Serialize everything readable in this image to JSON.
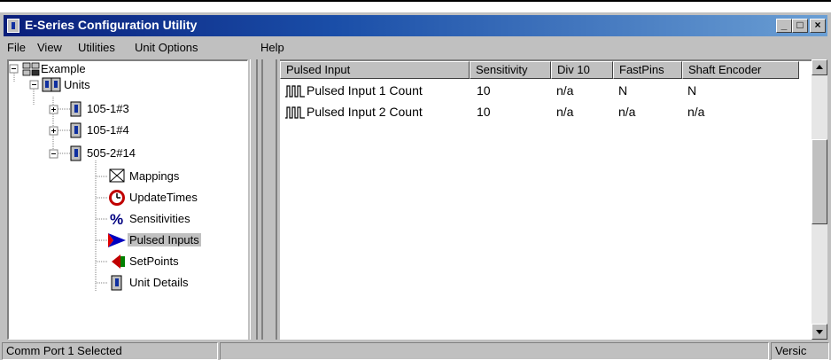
{
  "window": {
    "title": "E-Series Configuration Utility"
  },
  "menu": [
    "File",
    "View",
    "Utilities",
    "Unit Options",
    "Help"
  ],
  "tree": {
    "root": "Example",
    "units_label": "Units",
    "units": [
      "105-1#3",
      "105-1#4",
      "505-2#14"
    ],
    "children": [
      "Mappings",
      "UpdateTimes",
      "Sensitivities",
      "Pulsed Inputs",
      "SetPoints",
      "Unit Details"
    ],
    "selected": "Pulsed Inputs"
  },
  "table": {
    "columns": [
      "Pulsed Input",
      "Sensitivity",
      "Div 10",
      "FastPins",
      "Shaft Encoder"
    ],
    "rows": [
      [
        "Pulsed Input 1 Count",
        "10",
        "n/a",
        "N",
        "N"
      ],
      [
        "Pulsed Input 2 Count",
        "10",
        "n/a",
        "n/a",
        "n/a"
      ]
    ]
  },
  "status": {
    "left": "Comm Port 1 Selected",
    "right": "Versic"
  },
  "icons": {
    "app": "app-icon",
    "minimize": "minimize-icon",
    "maximize": "maximize-icon",
    "close": "close-icon",
    "tree_root": "network-icon",
    "unit": "unit-icon",
    "mappings": "mappings-icon",
    "update": "clock-icon",
    "sensitivities": "percent-icon",
    "pulsed": "arrow-icon",
    "setpoints": "setpoint-icon",
    "pulse_row": "pulse-wave-icon"
  },
  "colors": {
    "title_start": "#0a1e7a",
    "title_end": "#6b9fd4",
    "chrome": "#c0c0c0"
  }
}
